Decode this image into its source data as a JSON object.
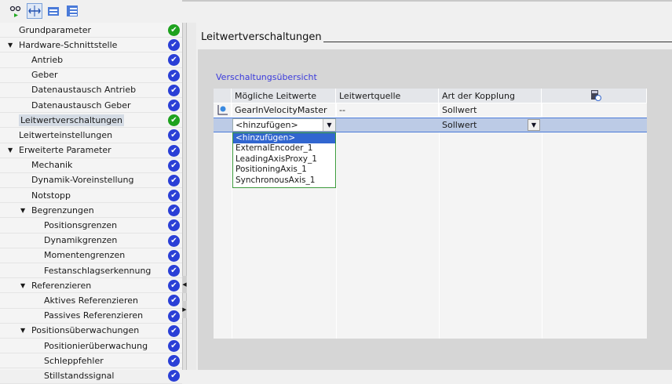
{
  "toolbar": {
    "icons": [
      "glasses-play-icon",
      "fit-width-icon",
      "folder-icon",
      "list-folder-icon"
    ]
  },
  "tree": [
    {
      "label": "Grundparameter",
      "level": 0,
      "status": "green"
    },
    {
      "label": "Hardware-Schnittstelle",
      "level": 0,
      "expanded": true,
      "status": "blue"
    },
    {
      "label": "Antrieb",
      "level": 1,
      "status": "blue"
    },
    {
      "label": "Geber",
      "level": 1,
      "status": "blue"
    },
    {
      "label": "Datenaustausch Antrieb",
      "level": 1,
      "status": "blue"
    },
    {
      "label": "Datenaustausch Geber",
      "level": 1,
      "status": "blue"
    },
    {
      "label": "Leitwertverschaltungen",
      "level": 0,
      "status": "green",
      "selected": true
    },
    {
      "label": "Leitwerteinstellungen",
      "level": 0,
      "status": "blue"
    },
    {
      "label": "Erweiterte Parameter",
      "level": 0,
      "expanded": true,
      "status": "blue"
    },
    {
      "label": "Mechanik",
      "level": 1,
      "status": "blue"
    },
    {
      "label": "Dynamik-Voreinstellung",
      "level": 1,
      "status": "blue"
    },
    {
      "label": "Notstopp",
      "level": 1,
      "status": "blue"
    },
    {
      "label": "Begrenzungen",
      "level": 1,
      "expanded": true,
      "status": "blue"
    },
    {
      "label": "Positionsgrenzen",
      "level": 2,
      "status": "blue"
    },
    {
      "label": "Dynamikgrenzen",
      "level": 2,
      "status": "blue"
    },
    {
      "label": "Momentengrenzen",
      "level": 2,
      "status": "blue"
    },
    {
      "label": "Festanschlagserkennung",
      "level": 2,
      "status": "blue"
    },
    {
      "label": "Referenzieren",
      "level": 1,
      "expanded": true,
      "status": "blue"
    },
    {
      "label": "Aktives Referenzieren",
      "level": 2,
      "status": "blue"
    },
    {
      "label": "Passives Referenzieren",
      "level": 2,
      "status": "blue"
    },
    {
      "label": "Positionsüberwachungen",
      "level": 1,
      "expanded": true,
      "status": "blue"
    },
    {
      "label": "Positionierüberwachung",
      "level": 2,
      "status": "blue"
    },
    {
      "label": "Schleppfehler",
      "level": 2,
      "status": "blue"
    },
    {
      "label": "Stillstandssignal",
      "level": 2,
      "status": "blue"
    }
  ],
  "main": {
    "title": "Leitwertverschaltungen",
    "subtitle": "Verschaltungsübersicht",
    "columns": [
      "Mögliche Leitwerte",
      "Leitwertquelle",
      "Art der Kopplung"
    ],
    "rows": [
      {
        "leitwert": "GearInVelocityMaster",
        "quelle": "--",
        "kopplung": "Sollwert"
      },
      {
        "leitwert": "<hinzufügen>",
        "quelle": "",
        "kopplung": "Sollwert"
      }
    ],
    "dropdown_options": [
      "<hinzufügen>",
      "ExternalEncoder_1",
      "LeadingAxisProxy_1",
      "PositioningAxis_1",
      "SynchronousAxis_1"
    ],
    "dropdown_highlighted": 0
  },
  "colors": {
    "green": "#1ea21e",
    "blue": "#2a3fd6",
    "selection": "#bccbe6",
    "accent": "#3166d0"
  }
}
